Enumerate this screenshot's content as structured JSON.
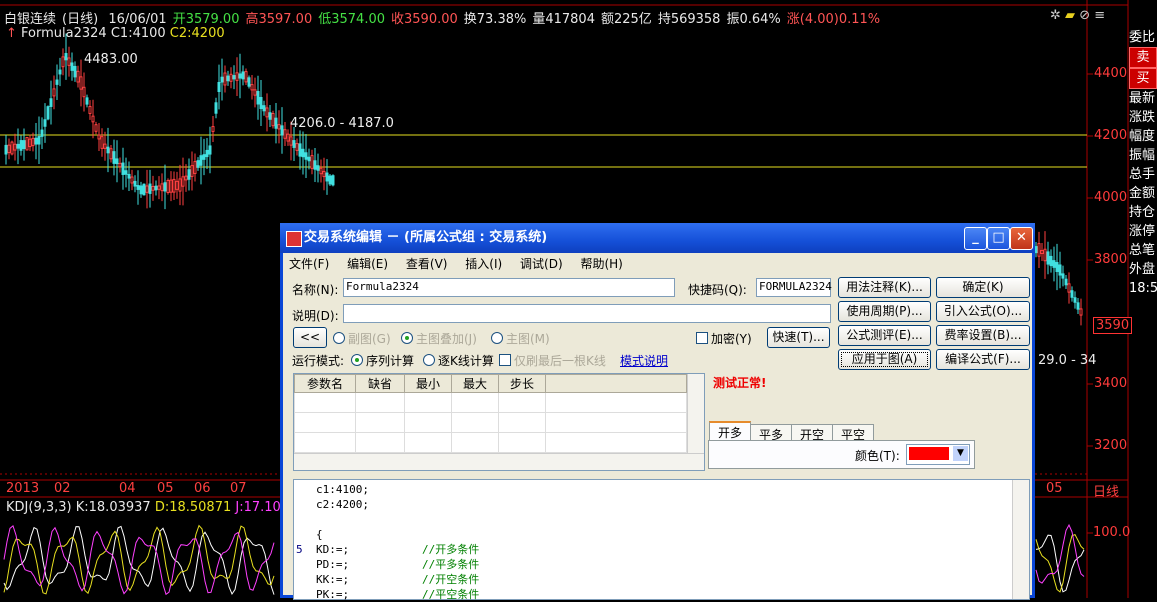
{
  "quote": {
    "name": "白银连续",
    "period": "(日线)",
    "date": "16/06/01",
    "open": "开3579.00",
    "high": "高3597.00",
    "low": "低3574.00",
    "close": "收3590.00",
    "turnover": "换73.38%",
    "volume": "量417804",
    "amount": "额225亿",
    "hold": "持569358",
    "amplitude": "振0.64%",
    "change": "涨(4.00)0.11%"
  },
  "formula": {
    "name": "Formula2324",
    "c1": "C1:4100",
    "c2": "C2:4200"
  },
  "annotations": {
    "peak": "4483.00",
    "range": "4206.0 - 4187.0",
    "right_cut": "29.0 - 34"
  },
  "price_axis": [
    "4400",
    "4200",
    "4000",
    "3800",
    "3600",
    "3400",
    "3200"
  ],
  "current_price": "3590",
  "x_axis": [
    "2013",
    "02",
    "04",
    "05",
    "06",
    "07",
    "05"
  ],
  "x_axis_unit": "日线",
  "kdj": {
    "title": "KDJ(9,3,3)",
    "k": "K:18.03937",
    "d": "D:18.50871",
    "j": "J:17.10"
  },
  "kdj_axis": "100.0",
  "right_panel": [
    "委比",
    "卖",
    "买",
    "最新",
    "涨跌",
    "幅度",
    "振幅",
    "总手",
    "金额",
    "持仓",
    "涨停",
    "总笔",
    "外盘",
    "18:5"
  ],
  "dialog": {
    "title": "交易系统编辑 － (所属公式组 : 交易系统)",
    "menu": [
      "文件(F)",
      "编辑(E)",
      "查看(V)",
      "插入(I)",
      "调试(D)",
      "帮助(H)"
    ],
    "name_label": "名称(N):",
    "name_value": "Formula2324",
    "shortcut_label": "快捷码(Q):",
    "shortcut_value": "FORMULA2324",
    "desc_label": "说明(D):",
    "desc_value": "",
    "back_btn": "<<",
    "radio_sub": "副图(G)",
    "radio_overlay": "主图叠加(J)",
    "radio_main": "主图(M)",
    "encrypt": "加密(Y)",
    "fast": "快速(T)...",
    "run_mode_label": "运行模式:",
    "run_seq": "序列计算",
    "run_kline": "逐K线计算",
    "refresh_last": "仅刷最后一根K线",
    "mode_help": "模式说明",
    "grid_headers": [
      "参数名",
      "缺省",
      "最小",
      "最大",
      "步长"
    ],
    "test_status": "测试正常!",
    "tabs": [
      "开多",
      "平多",
      "开空",
      "平空"
    ],
    "color_label": "颜色(T):",
    "color_value": "#ff0000",
    "buttons": {
      "usage": "用法注释(K)...",
      "period": "使用周期(P)...",
      "test": "公式测评(E)...",
      "apply": "应用于图(A)",
      "ok": "确定(K)",
      "import": "引入公式(O)...",
      "fee": "费率设置(B)...",
      "compile": "编译公式(F)..."
    },
    "code_lines": [
      "c1:4100;",
      "c2:4200;",
      "",
      "{",
      "KD:=;           //开多条件",
      "PD:=;           //平多条件",
      "KK:=;           //开空条件",
      "PK:=;           //平空条件"
    ],
    "line_number": "5"
  }
}
